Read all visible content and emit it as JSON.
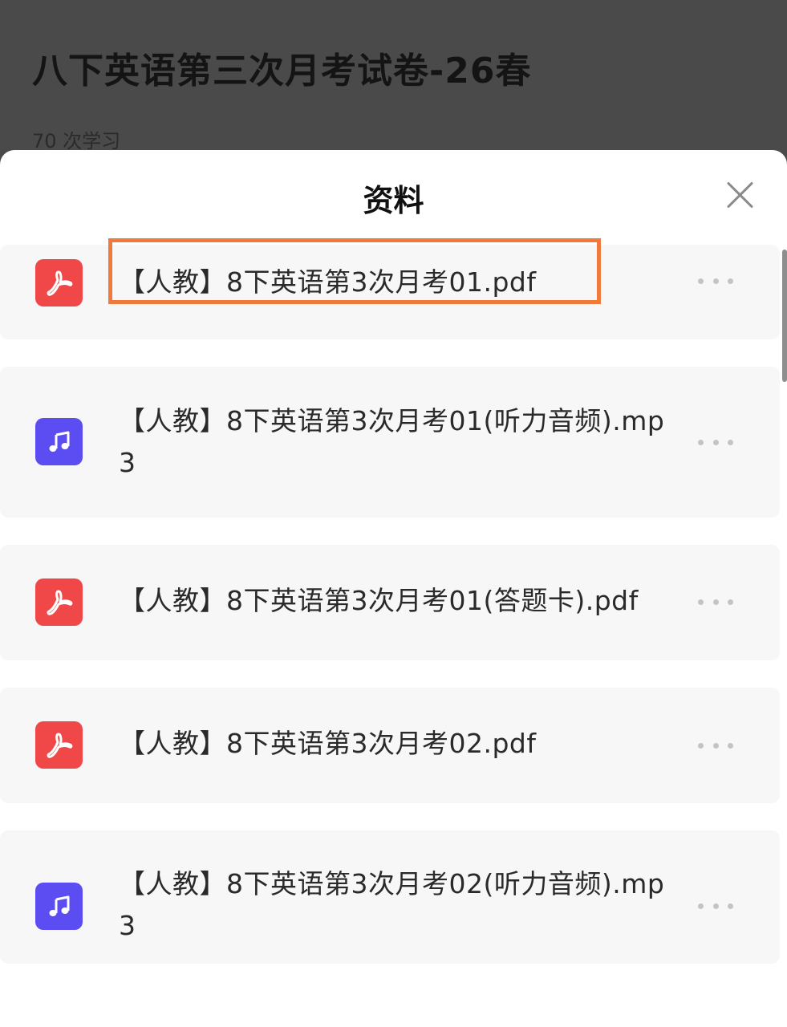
{
  "background": {
    "title": "八下英语第三次月考试卷-26春",
    "study_count": "70 次学习"
  },
  "sheet": {
    "title": "资料",
    "close_icon": "close-icon"
  },
  "files": [
    {
      "name": "【人教】8下英语第3次月考01.pdf",
      "type": "pdf",
      "icon": "pdf-icon",
      "highlighted": true
    },
    {
      "name": "【人教】8下英语第3次月考01(听力音频).mp3",
      "type": "audio",
      "icon": "music-note-icon",
      "highlighted": false
    },
    {
      "name": "【人教】8下英语第3次月考01(答题卡).pdf",
      "type": "pdf",
      "icon": "pdf-icon",
      "highlighted": false
    },
    {
      "name": "【人教】8下英语第3次月考02.pdf",
      "type": "pdf",
      "icon": "pdf-icon",
      "highlighted": false
    },
    {
      "name": "【人教】8下英语第3次月考02(听力音频).mp3",
      "type": "audio",
      "icon": "music-note-icon",
      "highlighted": false
    }
  ],
  "colors": {
    "pdf": "#f04848",
    "audio": "#5b4df2",
    "highlight": "#f07a3c"
  }
}
